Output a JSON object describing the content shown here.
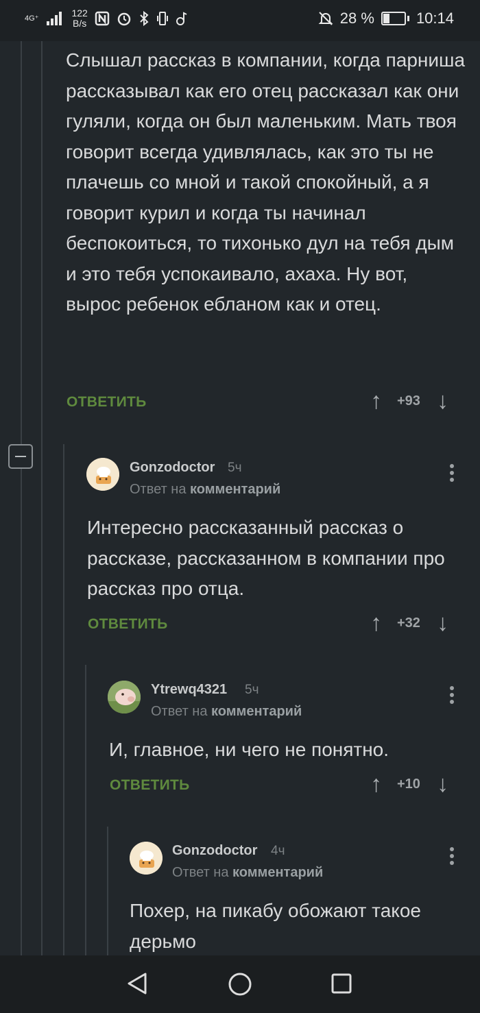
{
  "status_bar": {
    "network": "4G⁺",
    "net_speed_value": "122",
    "net_speed_unit": "B/s",
    "battery_percent": "28 %",
    "battery_level": 0.28,
    "time": "10:14"
  },
  "colors": {
    "background": "#22272b",
    "accent_green": "#5f8a3e",
    "text": "#d9dadb",
    "muted": "#7d8285"
  },
  "comments": [
    {
      "text": "Слышал рассказ в компании, когда парниша рассказывал как его отец рассказал как они гуляли, когда он был маленьким. Мать твоя говорит всегда удивлялась, как это ты не плачешь со мной и такой спокойный, а я говорит курил и когда ты начинал беспокоиться, то тихонько дул на тебя дым и это тебя успокаивало, ахаха. Ну вот, вырос ребенок ебланом как и отец.",
      "reply_label": "ОТВЕТИТЬ",
      "score": "+93"
    },
    {
      "author": "Gonzodoctor",
      "time": "5ч",
      "reply_to_prefix": "Ответ на",
      "reply_to_link": "комментарий",
      "text": "Интересно рассказанный рассказ о рассказе, рассказанном в компании про рассказ про отца.",
      "reply_label": "ОТВЕТИТЬ",
      "score": "+32",
      "avatar_icon": "chef-avatar-icon"
    },
    {
      "author": "Ytrewq4321",
      "time": "5ч",
      "reply_to_prefix": "Ответ на",
      "reply_to_link": "комментарий",
      "text": "И, главное, ни чего не понятно.",
      "reply_label": "ОТВЕТИТЬ",
      "score": "+10",
      "avatar_icon": "pig-avatar-icon"
    },
    {
      "author": "Gonzodoctor",
      "time": "4ч",
      "reply_to_prefix": "Ответ на",
      "reply_to_link": "комментарий",
      "text": "Похер, на пикабу обожают такое дерьмо",
      "avatar_icon": "chef-avatar-icon"
    }
  ],
  "nav_bar": {
    "back": "back-triangle-icon",
    "home": "home-circle-icon",
    "recents": "recents-square-icon"
  }
}
